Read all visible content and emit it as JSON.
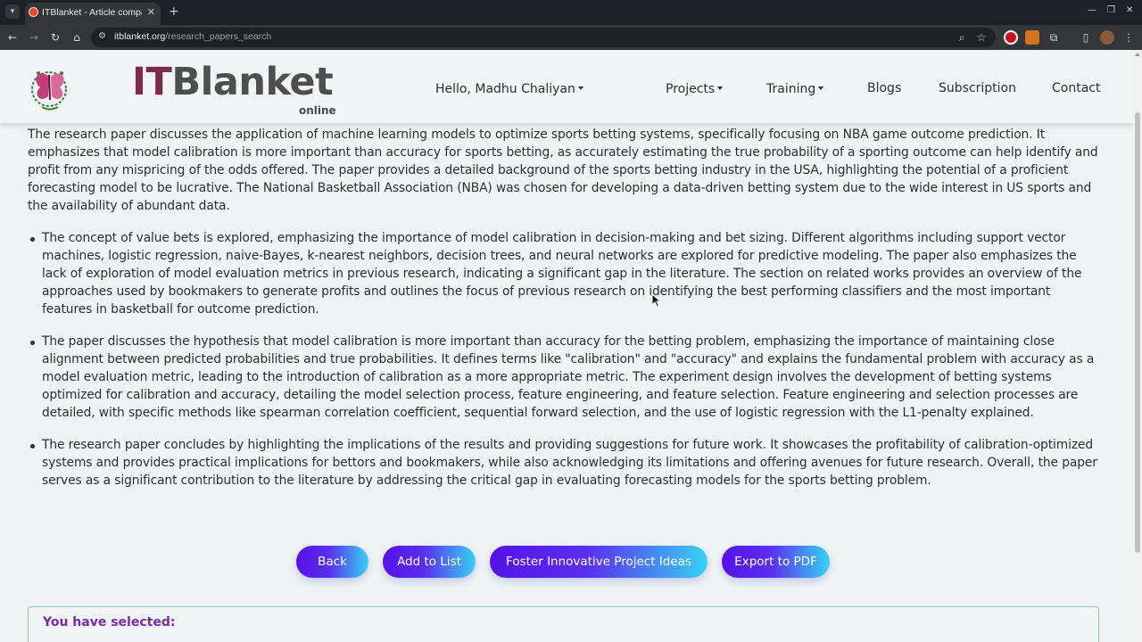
{
  "browser": {
    "tab_title": "ITBlanket - Article compa",
    "url_host": "itblanket.org",
    "url_path": "/research_papers_search"
  },
  "header": {
    "brand_it": "IT",
    "brand_blanket": "Blanket",
    "brand_sub": "online",
    "greeting": "Hello, Madhu Chaliyan",
    "nav": {
      "projects": "Projects",
      "training": "Training",
      "blogs": "Blogs",
      "subscription": "Subscription",
      "contact": "Contact"
    }
  },
  "content": {
    "summary": "The research paper discusses the application of machine learning models to optimize sports betting systems, specifically focusing on NBA game outcome prediction. It emphasizes that model calibration is more important than accuracy for sports betting, as accurately estimating the true probability of a sporting outcome can help identify and profit from any mispricing of the odds offered. The paper provides a detailed background of the sports betting industry in the USA, highlighting the potential of a proficient forecasting model to be lucrative. The National Basketball Association (NBA) was chosen for developing a data-driven betting system due to the wide interest in US sports and the availability of abundant data.",
    "points": [
      "The concept of value bets is explored, emphasizing the importance of model calibration in decision-making and bet sizing. Different algorithms including support vector machines, logistic regression, naive-Bayes, k-nearest neighbors, decision trees, and neural networks are explored for predictive modeling. The paper also emphasizes the lack of exploration of model evaluation metrics in previous research, indicating a significant gap in the literature. The section on related works provides an overview of the approaches used by bookmakers to generate profits and outlines the focus of previous research on identifying the best performing classifiers and the most important features in basketball for outcome prediction.",
      "The paper discusses the hypothesis that model calibration is more important than accuracy for the betting problem, emphasizing the importance of maintaining close alignment between predicted probabilities and true probabilities. It defines terms like \"calibration\" and \"accuracy\" and explains the fundamental problem with accuracy as a model evaluation metric, leading to the introduction of calibration as a more appropriate metric. The experiment design involves the development of betting systems optimized for calibration and accuracy, detailing the model selection process, feature engineering, and feature selection. Feature engineering and selection processes are detailed, with specific methods like spearman correlation coefficient, sequential forward selection, and the use of logistic regression with the L1-penalty explained.",
      "The research paper concludes by highlighting the implications of the results and providing suggestions for future work. It showcases the profitability of calibration-optimized systems and provides practical implications for bettors and bookmakers, while also acknowledging its limitations and offering avenues for future research. Overall, the paper serves as a significant contribution to the literature by addressing the critical gap in evaluating forecasting models for the sports betting problem."
    ]
  },
  "actions": {
    "back": "Back",
    "add_to_list": "Add to List",
    "foster": "Foster Innovative Project Ideas",
    "export": "Export to PDF"
  },
  "selected": {
    "title": "You have selected:"
  },
  "colors": {
    "brand_it": "#7d2a4f",
    "brand_blanket": "#4e4e4e",
    "button_start": "#5512e6",
    "button_end": "#36d2f2",
    "selected_title": "#7b2aa4",
    "panel_border": "#8cc9a4"
  },
  "icons": {
    "tab_menu": "chevron-down-icon",
    "back": "arrow-left-icon",
    "forward": "arrow-right-icon",
    "reload": "reload-icon",
    "home": "home-icon",
    "site_info": "tune-icon",
    "zoom": "zoom-icon",
    "bookmark": "star-icon",
    "extensions": "puzzle-icon",
    "sidebar": "side-panel-icon",
    "profile": "avatar",
    "menu": "kebab-menu-icon"
  }
}
